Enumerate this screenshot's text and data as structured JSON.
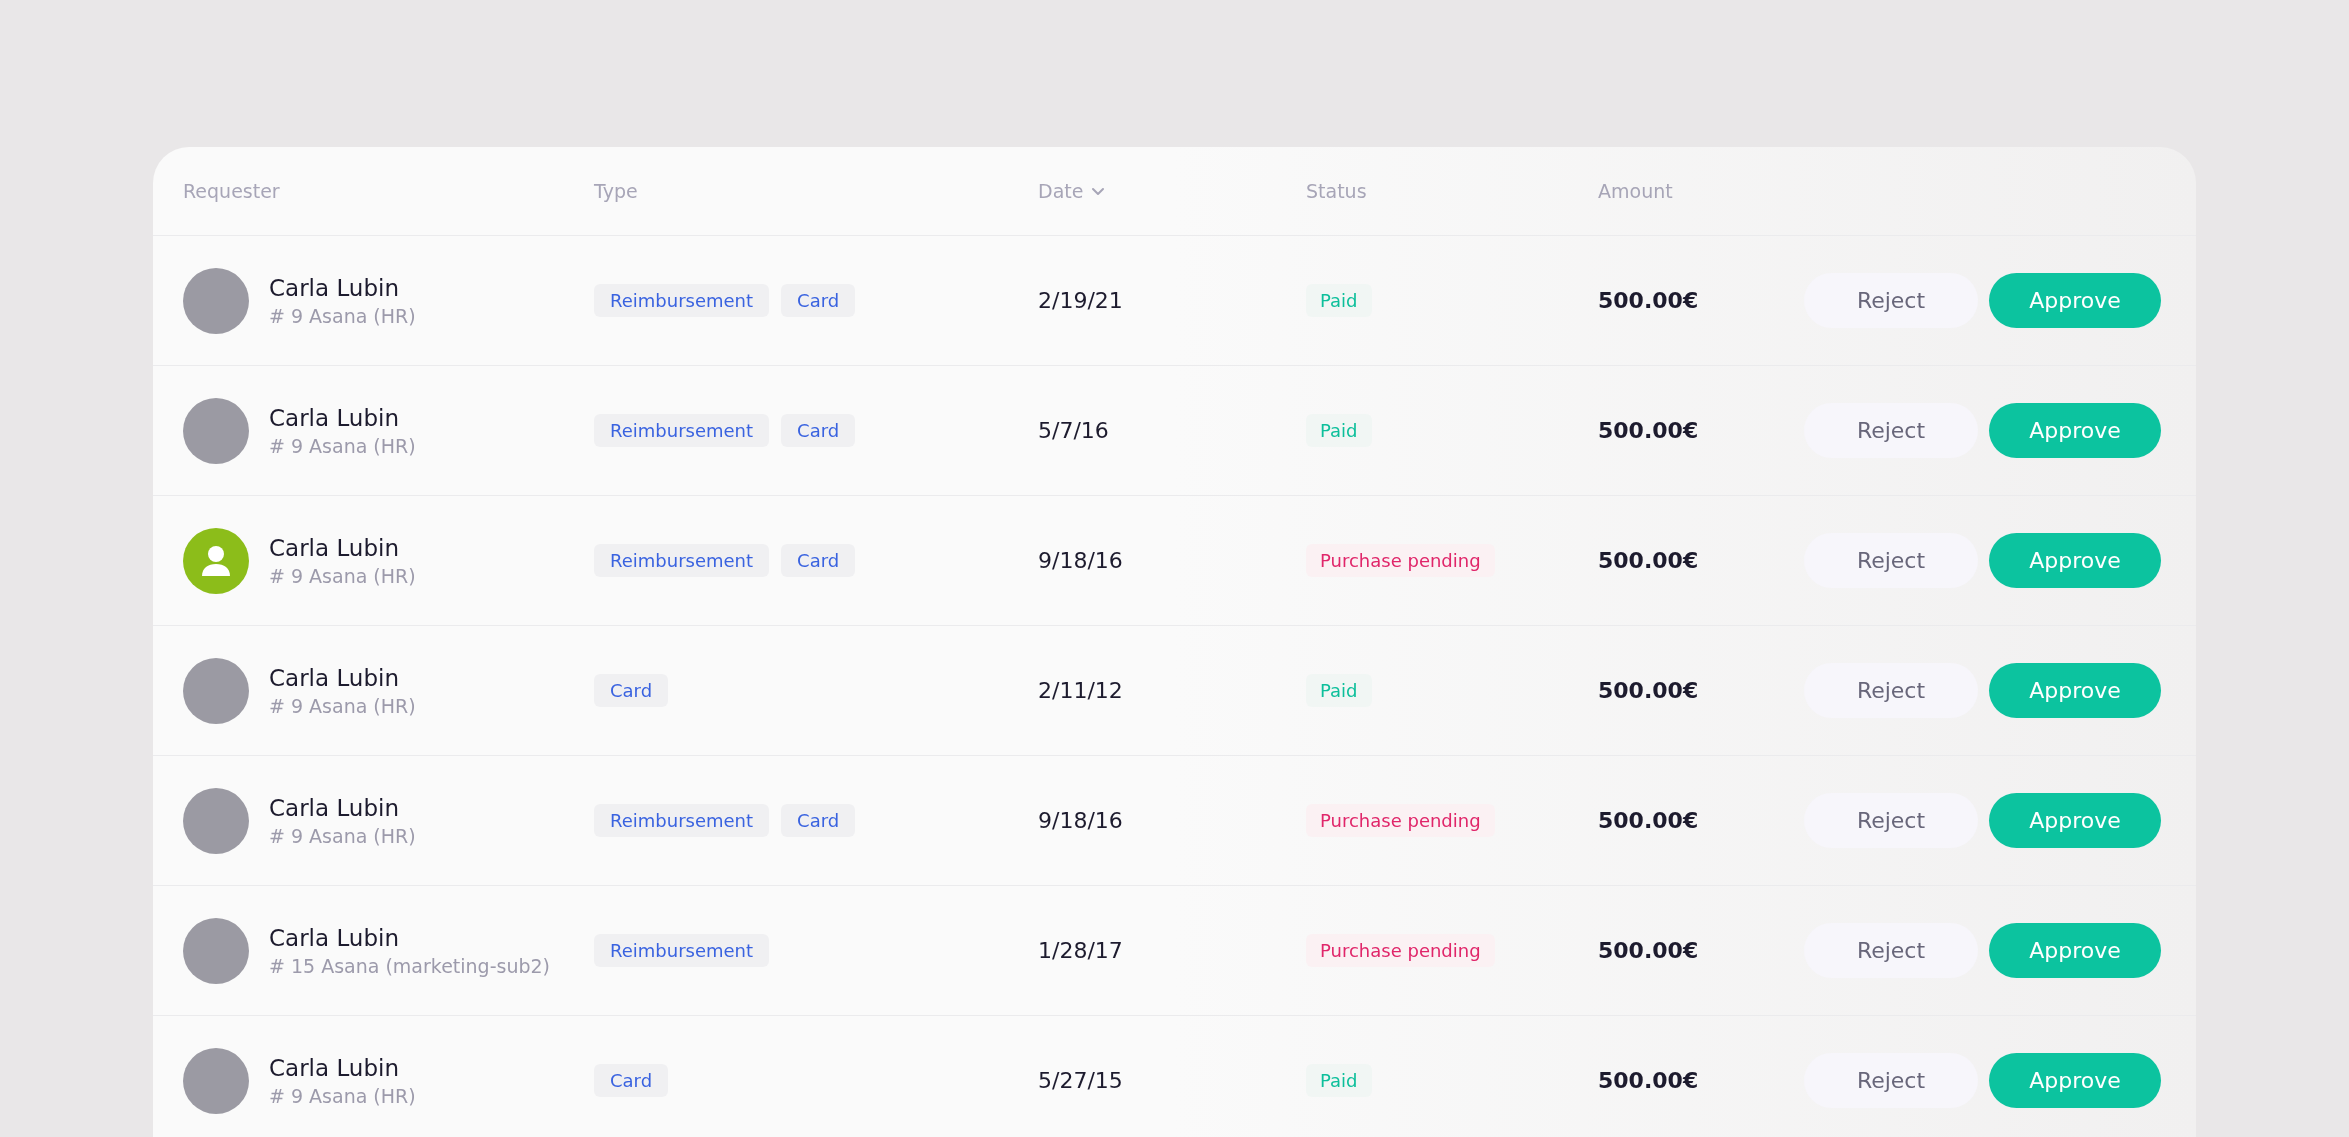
{
  "table": {
    "columns": [
      {
        "label": "Requester",
        "sorted": false
      },
      {
        "label": "Type",
        "sorted": false
      },
      {
        "label": "Date",
        "sorted": true
      },
      {
        "label": "Status",
        "sorted": false
      },
      {
        "label": "Amount",
        "sorted": false
      }
    ],
    "rows": [
      {
        "avatar": {
          "kind": "photo"
        },
        "name": "Carla Lubin",
        "team": "# 9 Asana (HR)",
        "types": [
          "Reimbursement",
          "Card"
        ],
        "date": "2/19/21",
        "status": {
          "kind": "paid",
          "label": "Paid"
        },
        "amount": "500.00€",
        "actions": [
          "Reject",
          "Approve"
        ]
      },
      {
        "avatar": {
          "kind": "photo"
        },
        "name": "Carla Lubin",
        "team": "# 9 Asana (HR)",
        "types": [
          "Reimbursement",
          "Card"
        ],
        "date": "5/7/16",
        "status": {
          "kind": "paid",
          "label": "Paid"
        },
        "amount": "500.00€",
        "actions": [
          "Reject",
          "Approve"
        ]
      },
      {
        "avatar": {
          "kind": "silhouette"
        },
        "name": "Carla Lubin",
        "team": "# 9 Asana (HR)",
        "types": [
          "Reimbursement",
          "Card"
        ],
        "date": "9/18/16",
        "status": {
          "kind": "pending",
          "label": "Purchase pending"
        },
        "amount": "500.00€",
        "actions": [
          "Reject",
          "Approve"
        ]
      },
      {
        "avatar": {
          "kind": "photo"
        },
        "name": "Carla Lubin",
        "team": "# 9 Asana (HR)",
        "types": [
          "Card"
        ],
        "date": "2/11/12",
        "status": {
          "kind": "paid",
          "label": "Paid"
        },
        "amount": "500.00€",
        "actions": [
          "Reject",
          "Approve"
        ]
      },
      {
        "avatar": {
          "kind": "photo"
        },
        "name": "Carla Lubin",
        "team": "# 9 Asana (HR)",
        "types": [
          "Reimbursement",
          "Card"
        ],
        "date": "9/18/16",
        "status": {
          "kind": "pending",
          "label": "Purchase pending"
        },
        "amount": "500.00€",
        "actions": [
          "Reject",
          "Approve"
        ]
      },
      {
        "avatar": {
          "kind": "photo"
        },
        "name": "Carla Lubin",
        "team": "# 15 Asana (marketing-sub2)",
        "types": [
          "Reimbursement"
        ],
        "date": "1/28/17",
        "status": {
          "kind": "pending",
          "label": "Purchase pending"
        },
        "amount": "500.00€",
        "actions": [
          "Reject",
          "Approve"
        ]
      },
      {
        "avatar": {
          "kind": "photo"
        },
        "name": "Carla Lubin",
        "team": "# 9 Asana (HR)",
        "types": [
          "Card"
        ],
        "date": "5/27/15",
        "status": {
          "kind": "paid",
          "label": "Paid"
        },
        "amount": "500.00€",
        "actions": [
          "Reject",
          "Approve"
        ]
      }
    ]
  }
}
